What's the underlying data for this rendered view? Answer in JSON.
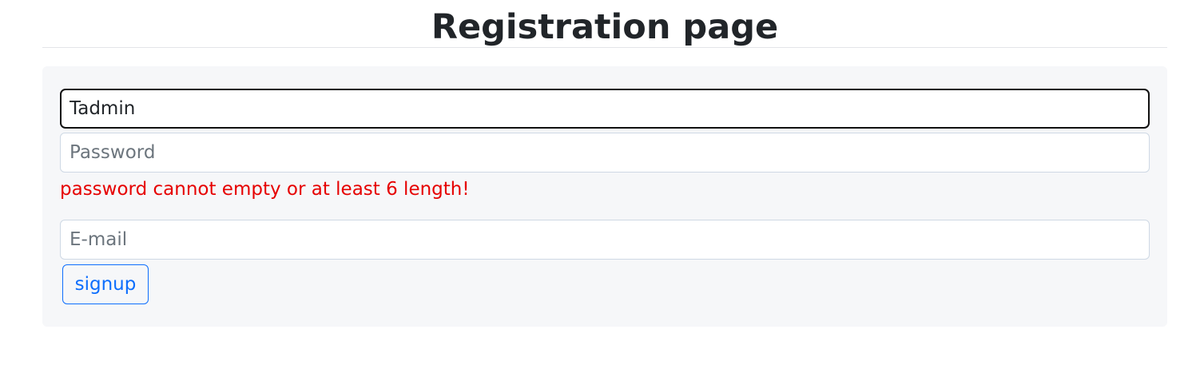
{
  "header": {
    "title": "Registration page"
  },
  "form": {
    "username": {
      "value": "Tadmin",
      "focused": true
    },
    "password": {
      "value": "",
      "placeholder": "Password"
    },
    "password_error": "password cannot empty or at least 6 length!",
    "email": {
      "value": "",
      "placeholder": "E-mail"
    },
    "submit_label": "signup"
  },
  "colors": {
    "error": "#e60000",
    "accent": "#0d6efd",
    "panel_background": "#f6f7f9",
    "focus_border": "#111111"
  }
}
